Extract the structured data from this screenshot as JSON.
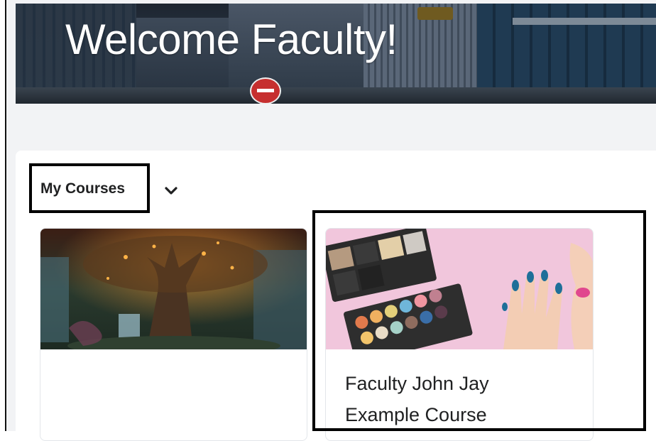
{
  "banner": {
    "title": "Welcome Faculty!"
  },
  "widget": {
    "title": "My Courses",
    "menu_icon": "chevron-down-icon"
  },
  "courses": [
    {
      "title": "",
      "image": "fantasy-tree-image"
    },
    {
      "title_line1": "Faculty John Jay",
      "title_line2": "Example Course",
      "image": "makeup-palette-image"
    }
  ],
  "colors": {
    "highlight": "#000000",
    "page_background": "#f2f3f5",
    "text": "#202122"
  }
}
